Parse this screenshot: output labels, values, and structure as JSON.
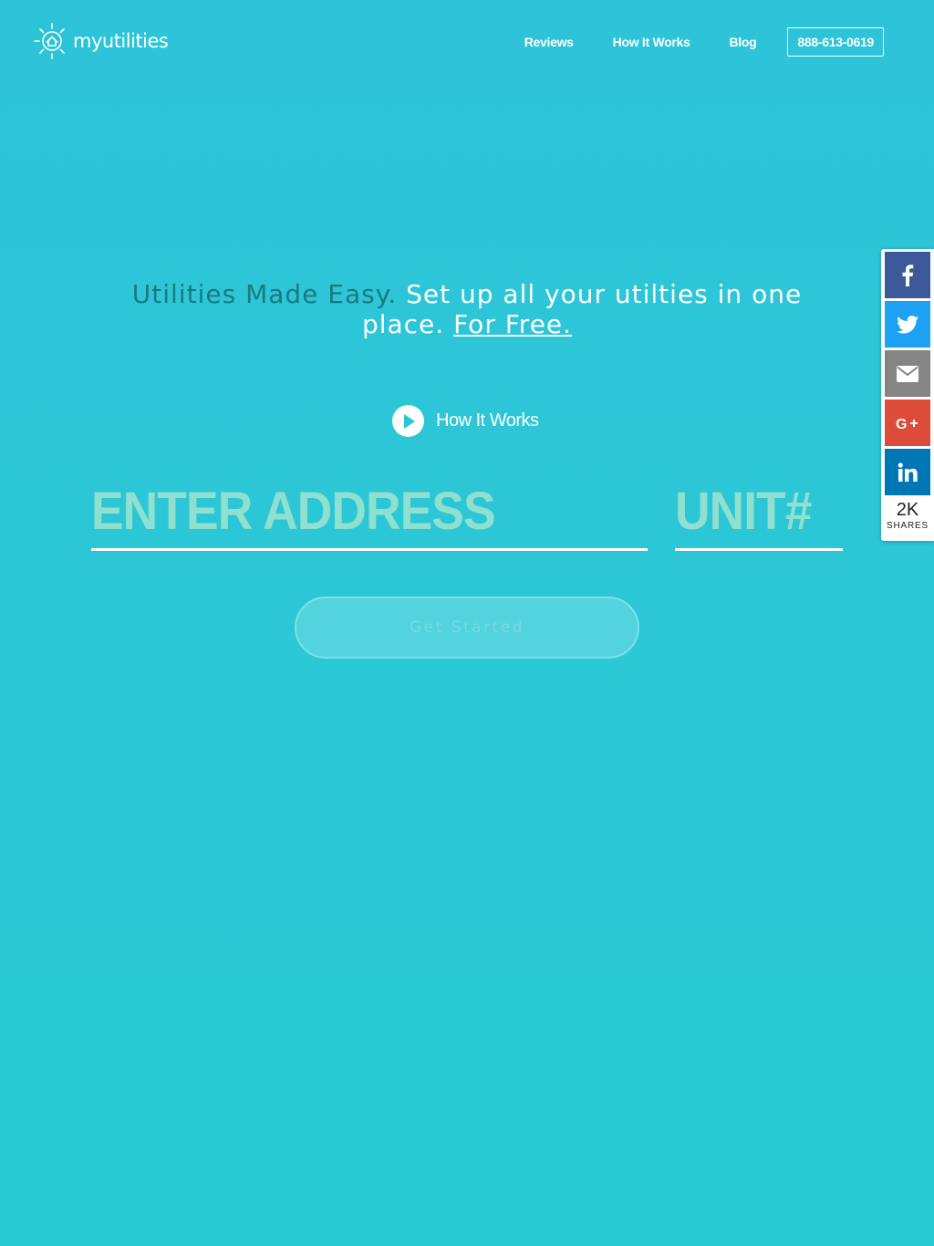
{
  "header": {
    "logo_text": "myutilities",
    "nav": [
      {
        "label": "Reviews"
      },
      {
        "label": "How It Works"
      },
      {
        "label": "Blog"
      }
    ],
    "phone": "888-613-0619"
  },
  "hero": {
    "headline_part1": "Utilities Made Easy.",
    "headline_part2": "Set up all your utilties in one place.",
    "headline_link": "For Free.",
    "how_it_works_label": "How It Works",
    "address_placeholder": "ENTER ADDRESS",
    "unit_placeholder": "UNIT#",
    "cta_label": "Get Started"
  },
  "share_bar": {
    "buttons": [
      {
        "network": "facebook",
        "icon": "facebook-icon",
        "color": "#3b5998"
      },
      {
        "network": "twitter",
        "icon": "twitter-icon",
        "color": "#1da1f2"
      },
      {
        "network": "email",
        "icon": "email-icon",
        "color": "#848484"
      },
      {
        "network": "google-plus",
        "icon": "google-plus-icon",
        "color": "#dd4b39"
      },
      {
        "network": "linkedin",
        "icon": "linkedin-icon",
        "color": "#0077b5"
      }
    ],
    "count": "2K",
    "count_label": "SHARES"
  },
  "colors": {
    "background": "#2cc6d8",
    "headline_dark": "#1b7a80",
    "placeholder": "#8fe0cf"
  }
}
